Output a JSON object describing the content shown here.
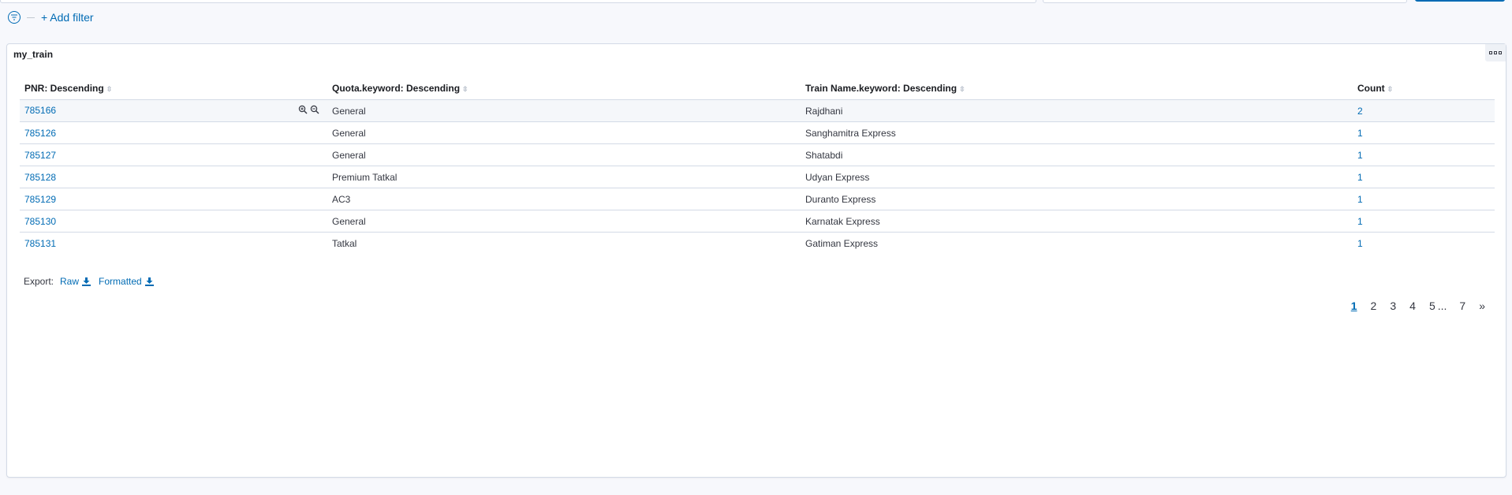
{
  "filter_bar": {
    "add_filter_label": "+ Add filter"
  },
  "panel": {
    "title": "my_train"
  },
  "table": {
    "columns": [
      "PNR: Descending",
      "Quota.keyword: Descending",
      "Train Name.keyword: Descending",
      "Count"
    ],
    "rows": [
      {
        "pnr": "785166",
        "quota": "General",
        "train": "Rajdhani",
        "count": "2"
      },
      {
        "pnr": "785126",
        "quota": "General",
        "train": "Sanghamitra Express",
        "count": "1"
      },
      {
        "pnr": "785127",
        "quota": "General",
        "train": "Shatabdi",
        "count": "1"
      },
      {
        "pnr": "785128",
        "quota": "Premium Tatkal",
        "train": "Udyan Express",
        "count": "1"
      },
      {
        "pnr": "785129",
        "quota": "AC3",
        "train": "Duranto Express",
        "count": "1"
      },
      {
        "pnr": "785130",
        "quota": "General",
        "train": "Karnatak Express",
        "count": "1"
      },
      {
        "pnr": "785131",
        "quota": "Tatkal",
        "train": "Gatiman Express",
        "count": "1"
      }
    ]
  },
  "export": {
    "label": "Export:",
    "raw": "Raw",
    "formatted": "Formatted"
  },
  "pagination": {
    "pages": [
      "1",
      "2",
      "3",
      "4",
      "5"
    ],
    "ellipsis": "...",
    "last": "7",
    "next": "»",
    "current": "1"
  },
  "colors": {
    "link": "#006bb4",
    "border": "#d3dae6",
    "background": "#f7f8fc"
  },
  "icons": [
    "filter-icon",
    "zoom-in-icon",
    "zoom-out-icon",
    "download-icon",
    "panel-options-icon",
    "sort-icon"
  ]
}
